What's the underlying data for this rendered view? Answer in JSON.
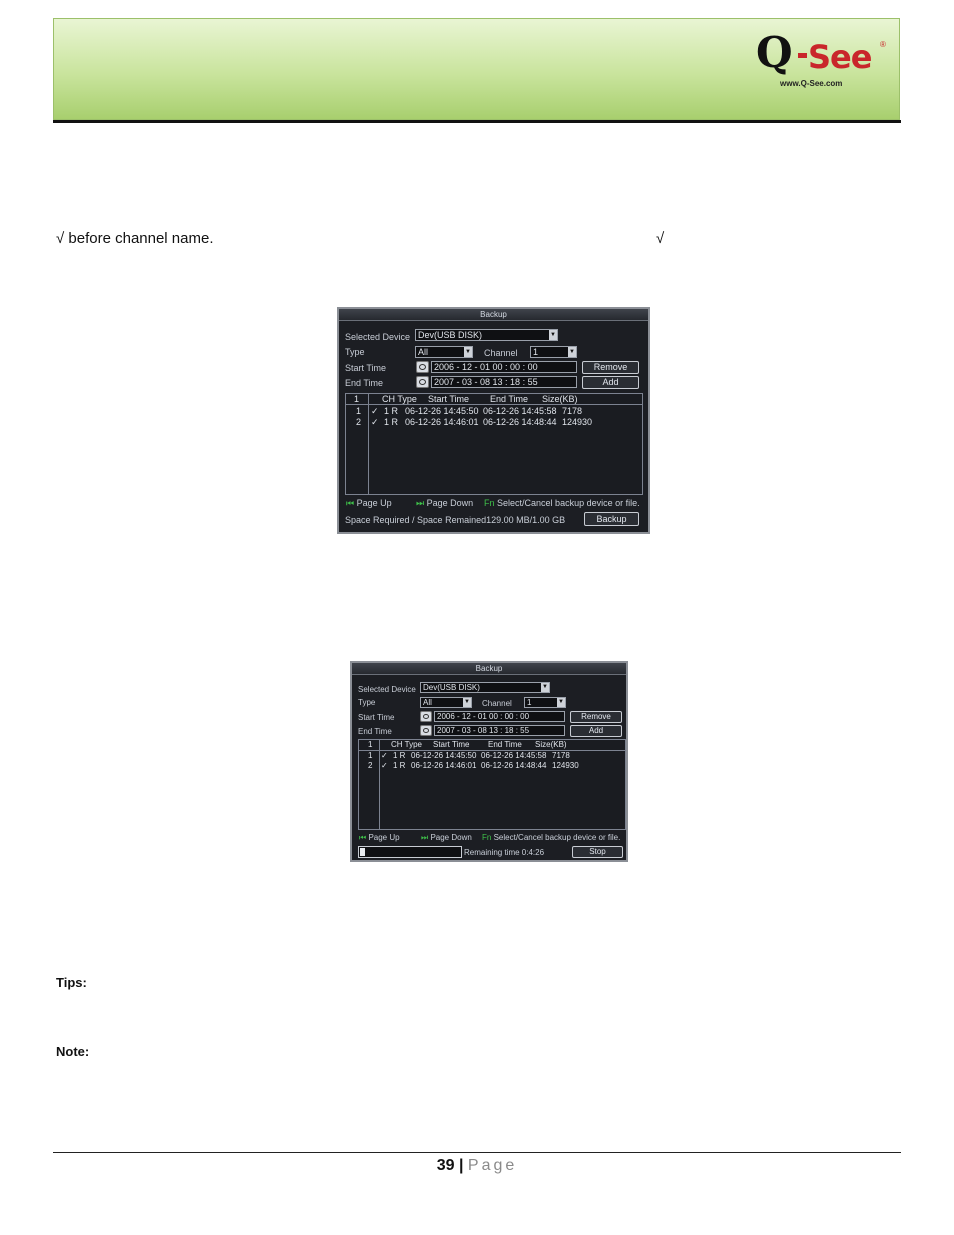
{
  "logo": {
    "q": "Q",
    "see": "See",
    "reg": "®",
    "url": "www.Q-See.com"
  },
  "body": {
    "check_line": "√ before channel name.",
    "check_tail": "√"
  },
  "dialog1": {
    "title": "Backup",
    "selected_device_label": "Selected Device",
    "selected_device_value": "Dev(USB DISK)",
    "type_label": "Type",
    "type_value": "All",
    "channel_label": "Channel",
    "channel_value": "1",
    "start_time_label": "Start Time",
    "start_time_value": "2006 - 12 - 01   00 : 00 : 00",
    "end_time_label": "End Time",
    "end_time_value": "2007 - 03 - 08   13 : 18 : 55",
    "remove_button": "Remove",
    "add_button": "Add",
    "columns": [
      "1",
      "CH Type",
      "Start Time",
      "End Time",
      "Size(KB)"
    ],
    "rows": [
      {
        "n": "1",
        "check": "✓",
        "ch": "1 R",
        "start": "06-12-26 14:45:50",
        "end": "06-12-26 14:45:58",
        "size": "7178"
      },
      {
        "n": "2",
        "check": "✓",
        "ch": "1 R",
        "start": "06-12-26 14:46:01",
        "end": "06-12-26 14:48:44",
        "size": "124930"
      }
    ],
    "page_up": "Page Up",
    "page_down": "Page Down",
    "select_hint": "Select/Cancel backup device or file.",
    "space_text": "Space Required / Space Remained129.00 MB/1.00 GB",
    "backup_button": "Backup"
  },
  "dialog2": {
    "title": "Backup",
    "selected_device_label": "Selected Device",
    "selected_device_value": "Dev(USB DISK)",
    "type_label": "Type",
    "type_value": "All",
    "channel_label": "Channel",
    "channel_value": "1",
    "start_time_label": "Start Time",
    "start_time_value": "2006 - 12 - 01   00 : 00 : 00",
    "end_time_label": "End Time",
    "end_time_value": "2007 - 03 - 08   13 : 18 : 55",
    "remove_button": "Remove",
    "add_button": "Add",
    "columns": [
      "1",
      "CH Type",
      "Start Time",
      "End Time",
      "Size(KB)"
    ],
    "rows": [
      {
        "n": "1",
        "check": "✓",
        "ch": "1 R",
        "start": "06-12-26 14:45:50",
        "end": "06-12-26 14:45:58",
        "size": "7178"
      },
      {
        "n": "2",
        "check": "✓",
        "ch": "1 R",
        "start": "06-12-26 14:46:01",
        "end": "06-12-26 14:48:44",
        "size": "124930"
      }
    ],
    "page_up": "Page Up",
    "page_down": "Page Down",
    "select_hint": "Select/Cancel backup device or file.",
    "progress_fraction": 0.05,
    "remaining_text": "Remaining time 0:4:26",
    "stop_button": "Stop"
  },
  "tips_label": "Tips:",
  "note_label": "Note:",
  "footer": {
    "page_number": "39",
    "separator": "|",
    "page_word": "Page"
  }
}
